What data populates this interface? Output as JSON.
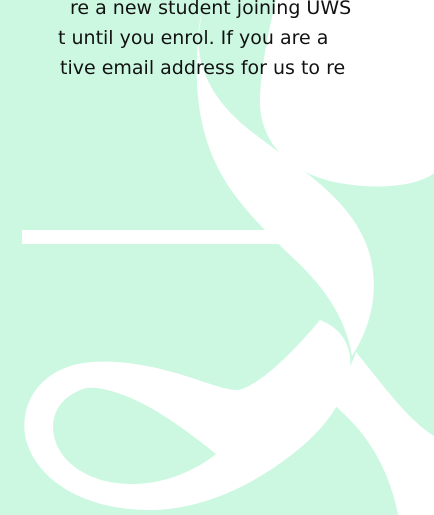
{
  "document": {
    "body_lines": [
      "re a new student joining UWS",
      "t until you enrol. If you are a",
      "tive email address for us to re"
    ]
  },
  "colors": {
    "background": "#ccf8e2",
    "artwork": "#ffffff",
    "text": "#111111"
  },
  "artwork": {
    "icon": "stylized-ampersand-logo"
  }
}
